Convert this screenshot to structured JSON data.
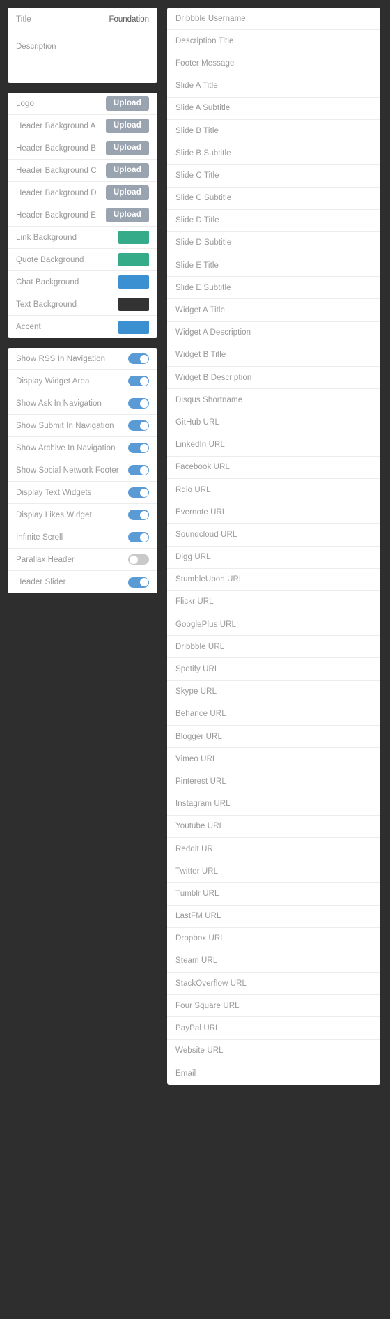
{
  "theme": {
    "background": "#2e2e2e",
    "panel_bg": "#ffffff",
    "label_color": "#9a9a9a",
    "upload_btn_color": "#9aa3b0",
    "toggle_on_color": "#5b9bd5",
    "toggle_off_color": "#c9c9c9"
  },
  "left": {
    "general_panel": {
      "title_label": "Title",
      "title_value": "Foundation",
      "description_label": "Description",
      "description_value": ""
    },
    "upload_label": "Upload",
    "assets_panel": {
      "uploads": [
        {
          "label": "Logo",
          "button": "Upload"
        },
        {
          "label": "Header Background A",
          "button": "Upload"
        },
        {
          "label": "Header Background B",
          "button": "Upload"
        },
        {
          "label": "Header Background C",
          "button": "Upload"
        },
        {
          "label": "Header Background D",
          "button": "Upload"
        },
        {
          "label": "Header Background E",
          "button": "Upload"
        }
      ],
      "colors": [
        {
          "label": "Link Background",
          "color": "#35ab8a"
        },
        {
          "label": "Quote Background",
          "color": "#35ab8a"
        },
        {
          "label": "Chat Background",
          "color": "#3a90d1"
        },
        {
          "label": "Text Background",
          "color": "#333333"
        },
        {
          "label": "Accent",
          "color": "#3a90d1"
        }
      ]
    },
    "toggles_panel": {
      "toggles": [
        {
          "label": "Show RSS In Navigation",
          "state": "on"
        },
        {
          "label": "Display Widget Area",
          "state": "on"
        },
        {
          "label": "Show Ask In Navigation",
          "state": "on"
        },
        {
          "label": "Show Submit In Navigation",
          "state": "on"
        },
        {
          "label": "Show Archive In Navigation",
          "state": "on"
        },
        {
          "label": "Show Social Network Footer",
          "state": "on"
        },
        {
          "label": "Display Text Widgets",
          "state": "on"
        },
        {
          "label": "Display Likes Widget",
          "state": "on"
        },
        {
          "label": "Infinite Scroll",
          "state": "on"
        },
        {
          "label": "Parallax Header",
          "state": "off"
        },
        {
          "label": "Header Slider",
          "state": "on"
        }
      ]
    }
  },
  "right": {
    "fields": [
      {
        "label": "Dribbble Username"
      },
      {
        "label": "Description Title"
      },
      {
        "label": "Footer Message"
      },
      {
        "label": "Slide A Title"
      },
      {
        "label": "Slide A Subtitle"
      },
      {
        "label": "Slide B Title"
      },
      {
        "label": "Slide B Subtitle"
      },
      {
        "label": "Slide C Title"
      },
      {
        "label": "Slide C Subtitle"
      },
      {
        "label": "Slide D Title"
      },
      {
        "label": "Slide D Subtitle"
      },
      {
        "label": "Slide E Title"
      },
      {
        "label": "Slide E Subtitle"
      },
      {
        "label": "Widget A Title"
      },
      {
        "label": "Widget A Description"
      },
      {
        "label": "Widget B Title"
      },
      {
        "label": "Widget B Description"
      },
      {
        "label": "Disqus Shortname"
      },
      {
        "label": "GitHub URL"
      },
      {
        "label": "LinkedIn URL"
      },
      {
        "label": "Facebook URL"
      },
      {
        "label": "Rdio URL"
      },
      {
        "label": "Evernote URL"
      },
      {
        "label": "Soundcloud URL"
      },
      {
        "label": "Digg URL"
      },
      {
        "label": "StumbleUpon URL"
      },
      {
        "label": "Flickr URL"
      },
      {
        "label": "GooglePlus URL"
      },
      {
        "label": "Dribbble URL"
      },
      {
        "label": "Spotify URL"
      },
      {
        "label": "Skype URL"
      },
      {
        "label": "Behance URL"
      },
      {
        "label": "Blogger URL"
      },
      {
        "label": "Vimeo URL"
      },
      {
        "label": "Pinterest URL"
      },
      {
        "label": "Instagram URL"
      },
      {
        "label": "Youtube URL"
      },
      {
        "label": "Reddit URL"
      },
      {
        "label": "Twitter URL"
      },
      {
        "label": "Tumblr URL"
      },
      {
        "label": "LastFM URL"
      },
      {
        "label": "Dropbox URL"
      },
      {
        "label": "Steam URL"
      },
      {
        "label": "StackOverflow URL"
      },
      {
        "label": "Four Square URL"
      },
      {
        "label": "PayPal URL"
      },
      {
        "label": "Website URL"
      },
      {
        "label": "Email"
      }
    ]
  }
}
